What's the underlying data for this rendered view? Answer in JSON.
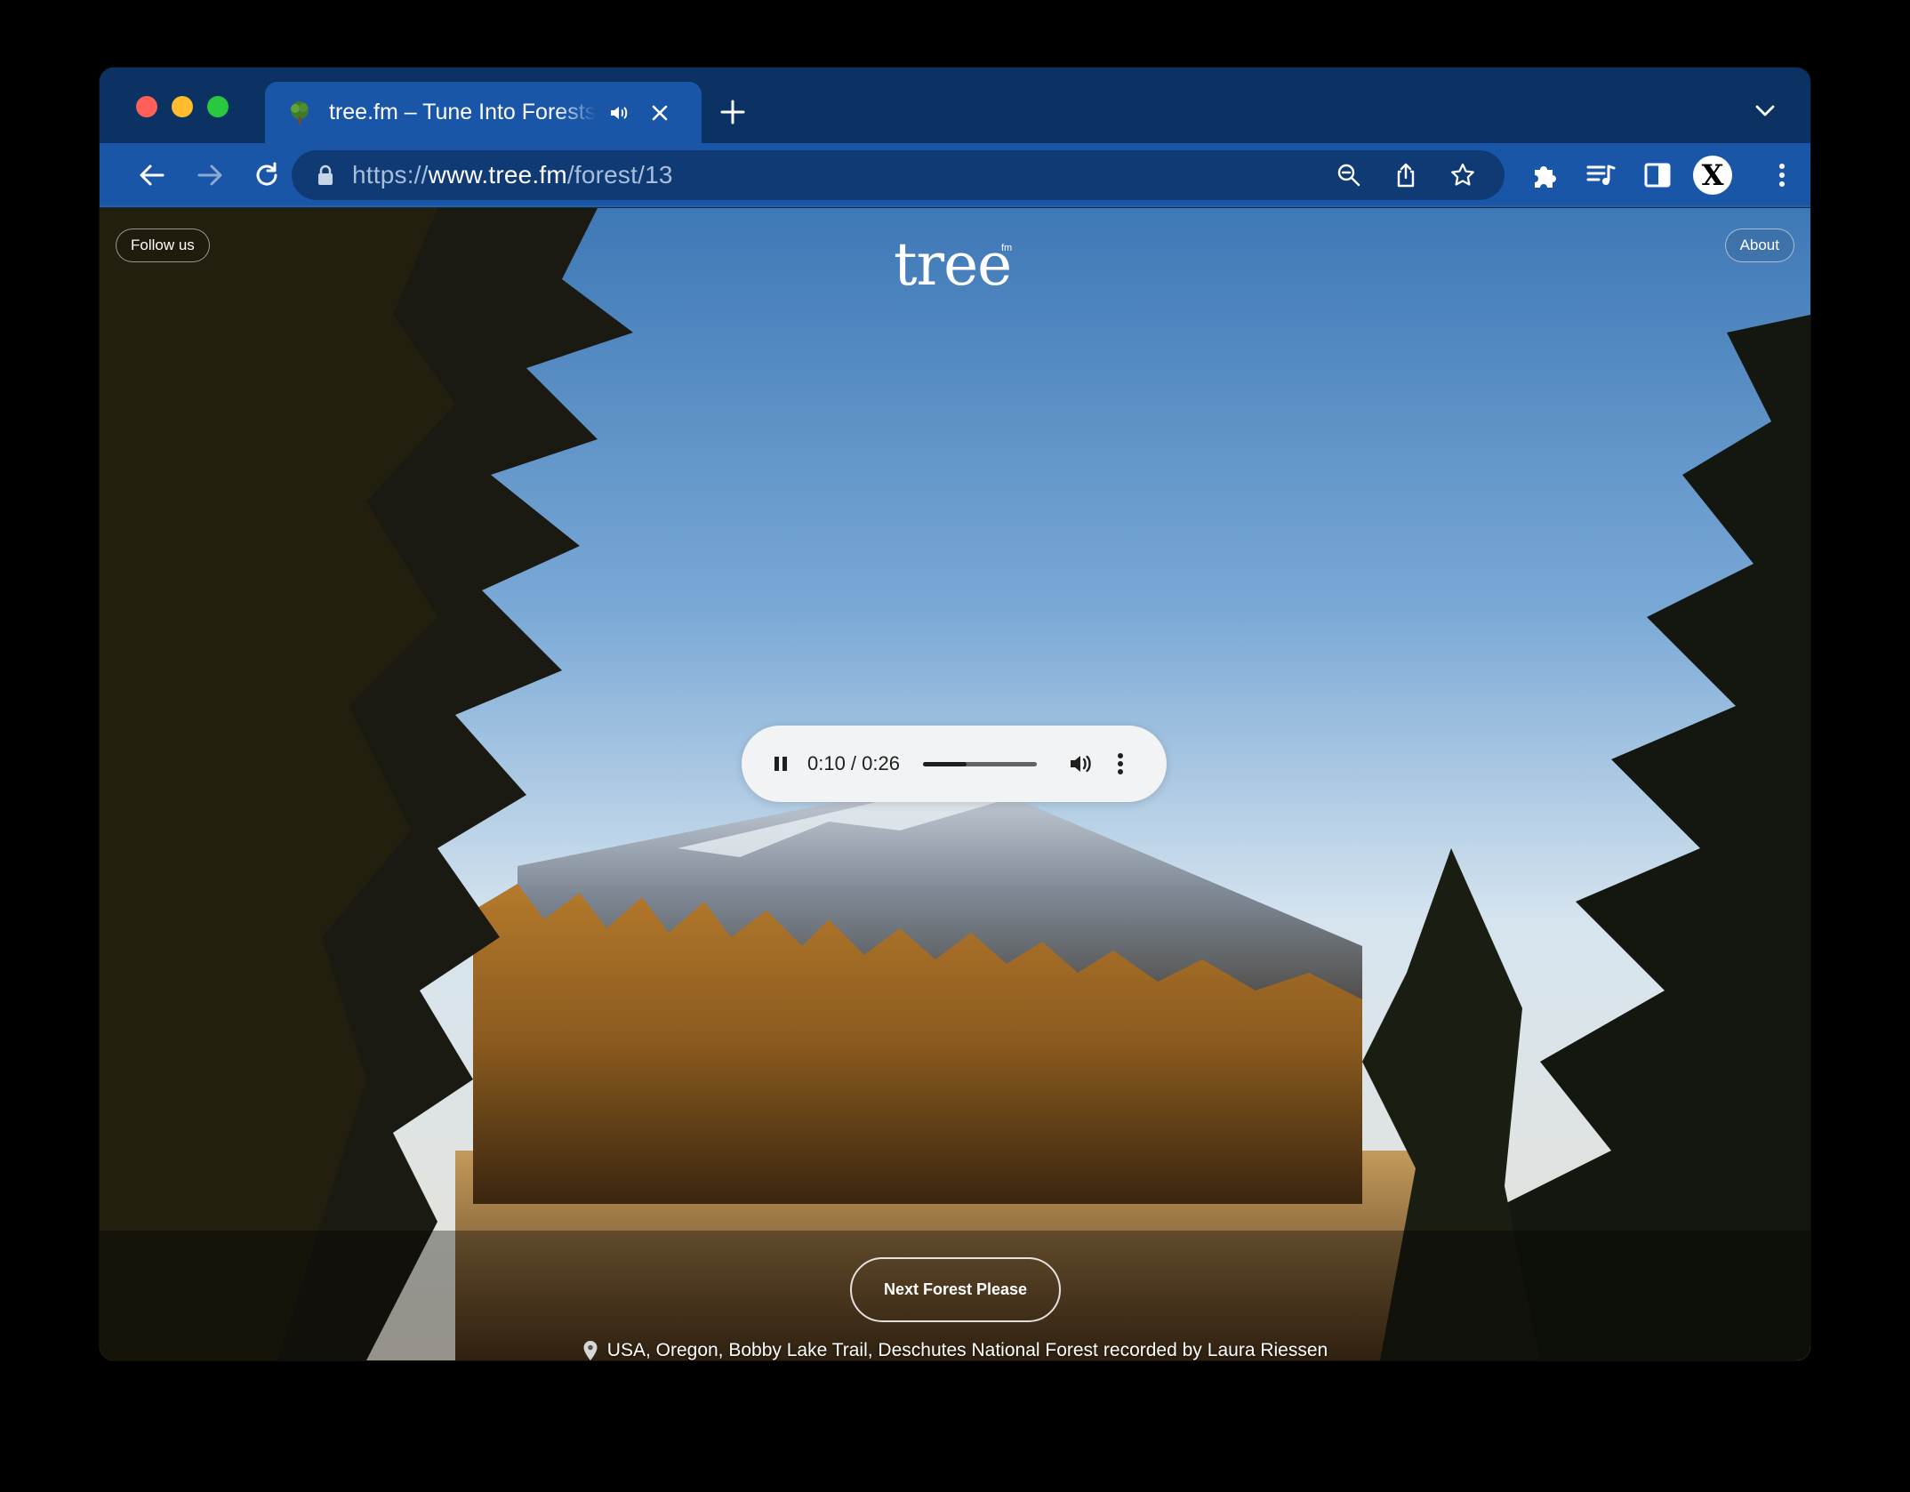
{
  "browser": {
    "tab": {
      "title": "tree.fm – Tune Into Forests",
      "favicon": "tree-icon",
      "audio_icon": "speaker-icon",
      "close_icon": "close-icon"
    },
    "new_tab_icon": "plus-icon",
    "tab_search_icon": "chevron-down-icon",
    "url": {
      "scheme": "https://",
      "host": "www.tree.fm",
      "path": "/forest/13"
    },
    "toolbar_icons": [
      "back-arrow-icon",
      "forward-arrow-icon",
      "reload-icon",
      "lock-icon",
      "zoom-icon",
      "share-icon",
      "star-icon",
      "puzzle-icon",
      "media-queue-icon",
      "side-panel-icon",
      "kebab-menu-icon"
    ],
    "profile_initial": "X"
  },
  "page": {
    "follow_label": "Follow us",
    "about_label": "About",
    "logo_text": "tree",
    "logo_sup": "fm",
    "player": {
      "time": "0:10 / 0:26",
      "progress": 0.385
    },
    "next_button": "Next Forest Please",
    "credit": {
      "location": "USA, Oregon, Bobby Lake Trail, Deschutes National Forest",
      "recorded_by_label": "recorded by",
      "author": "Laura Riessen"
    }
  },
  "colors": {
    "tabstrip": "#0b3262",
    "toolbar": "#1a56a8",
    "omnibox": "#0f3a74",
    "player_bg": "#f1f3f4"
  }
}
